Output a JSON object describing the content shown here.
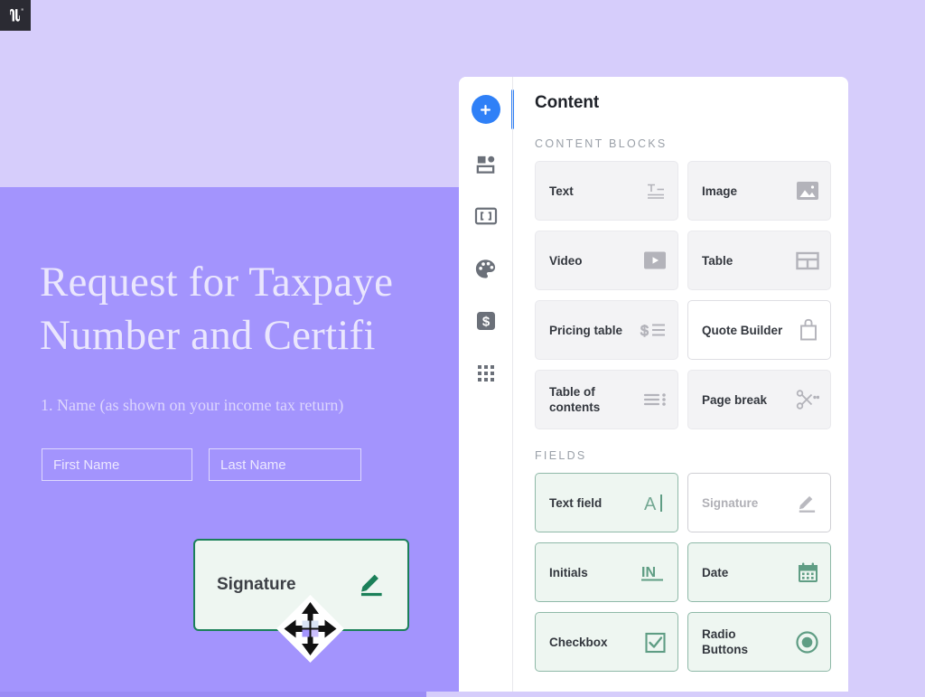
{
  "app": {
    "logo_name": "pandadoc-logo"
  },
  "document": {
    "title_line1": "Request for Taxpaye",
    "title_line2": "Number and Certifi",
    "question": "1. Name (as shown on your income tax return)",
    "inputs": [
      {
        "name": "first-name",
        "placeholder": "First Name"
      },
      {
        "name": "last-name",
        "placeholder": "Last Name"
      }
    ],
    "dragged_field": {
      "label": "Signature",
      "icon": "signature-pen-icon",
      "cursor": "move-cursor",
      "border_color": "#1b8059",
      "background_color": "#eef6f1"
    },
    "background_top": "#d6cdfb",
    "background_body": "#a394fd"
  },
  "panel": {
    "title": "Content",
    "accent_color": "#2f80f7",
    "rail": [
      {
        "name": "add-content-button",
        "label": "Add",
        "icon": "plus-icon",
        "active": true
      },
      {
        "name": "rail-item-layout",
        "label": "Layout",
        "icon": "layout-blocks-icon",
        "active": false
      },
      {
        "name": "rail-item-variables",
        "label": "Variables",
        "icon": "brackets-icon",
        "active": false
      },
      {
        "name": "rail-item-theme",
        "label": "Theme",
        "icon": "palette-icon",
        "active": false
      },
      {
        "name": "rail-item-pricing",
        "label": "Pricing",
        "icon": "dollar-icon",
        "active": false
      },
      {
        "name": "rail-item-apps",
        "label": "Apps",
        "icon": "grid-apps-icon",
        "active": false
      }
    ],
    "sections": [
      {
        "name": "content-blocks",
        "label": "CONTENT BLOCKS",
        "items": [
          {
            "label": "Text",
            "icon": "text-format-icon",
            "state": "normal"
          },
          {
            "label": "Image",
            "icon": "image-icon",
            "state": "normal"
          },
          {
            "label": "Video",
            "icon": "video-play-icon",
            "state": "normal"
          },
          {
            "label": "Table",
            "icon": "table-icon",
            "state": "normal"
          },
          {
            "label": "Pricing table",
            "icon": "pricing-table-icon",
            "state": "normal"
          },
          {
            "label": "Quote Builder",
            "icon": "quote-bag-icon",
            "state": "ghost"
          },
          {
            "label": "Table of contents",
            "icon": "toc-icon",
            "state": "normal"
          },
          {
            "label": "Page break",
            "icon": "scissors-icon",
            "state": "normal"
          }
        ]
      },
      {
        "name": "fields",
        "label": "FIELDS",
        "items": [
          {
            "label": "Text field",
            "icon": "text-cursor-icon",
            "state": "normal"
          },
          {
            "label": "Signature",
            "icon": "signature-pen-icon",
            "state": "disabled"
          },
          {
            "label": "Initials",
            "icon": "initials-icon",
            "state": "normal"
          },
          {
            "label": "Date",
            "icon": "calendar-icon",
            "state": "normal"
          },
          {
            "label": "Checkbox",
            "icon": "checkbox-icon",
            "state": "normal"
          },
          {
            "label": "Radio Buttons",
            "icon": "radio-button-icon",
            "state": "normal"
          }
        ]
      }
    ]
  },
  "scrollbar": {
    "name": "horizontal-scrollbar",
    "thumb_color": "#9b8cf5",
    "track_color": "#d6cdfb"
  }
}
